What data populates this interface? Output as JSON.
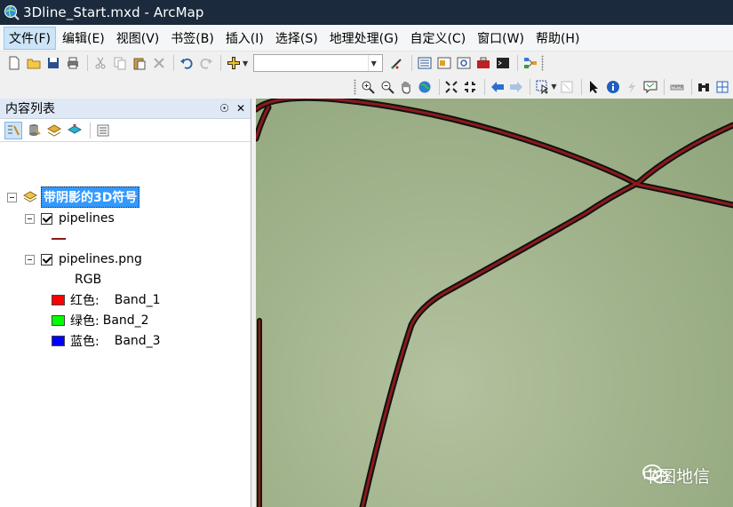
{
  "window": {
    "title": "3Dline_Start.mxd - ArcMap",
    "icon": "globe-app-icon"
  },
  "menu": [
    {
      "label": "文件(F)",
      "active": true
    },
    {
      "label": "编辑(E)"
    },
    {
      "label": "视图(V)"
    },
    {
      "label": "书签(B)"
    },
    {
      "label": "插入(I)"
    },
    {
      "label": "选择(S)"
    },
    {
      "label": "地理处理(G)"
    },
    {
      "label": "自定义(C)"
    },
    {
      "label": "窗口(W)"
    },
    {
      "label": "帮助(H)"
    }
  ],
  "toolbar": {
    "scale_value": ""
  },
  "toc": {
    "title": "内容列表",
    "pin_glyph": "☉",
    "close_glyph": "✕",
    "group": {
      "label": "带阴影的3D符号"
    },
    "layers": [
      {
        "name": "pipelines",
        "checked": true,
        "symbol_color": "#8b1a1a"
      },
      {
        "name": "pipelines.png",
        "checked": true,
        "renderer": "RGB",
        "bands": [
          {
            "channel": "红色:",
            "band": "Band_1",
            "color": "#ff0000"
          },
          {
            "channel": "绿色:",
            "band": "Band_2",
            "color": "#00ff00"
          },
          {
            "channel": "蓝色:",
            "band": "Band_3",
            "color": "#0000ff"
          }
        ]
      }
    ]
  },
  "watermark": {
    "text": "中图地信",
    "icon": "wechat-icon"
  },
  "colors": {
    "titlebar": "#1b2a3c",
    "selection": "#3399ff",
    "map_bg": "#a2b48d",
    "pipeline": "#8b1a1a"
  }
}
